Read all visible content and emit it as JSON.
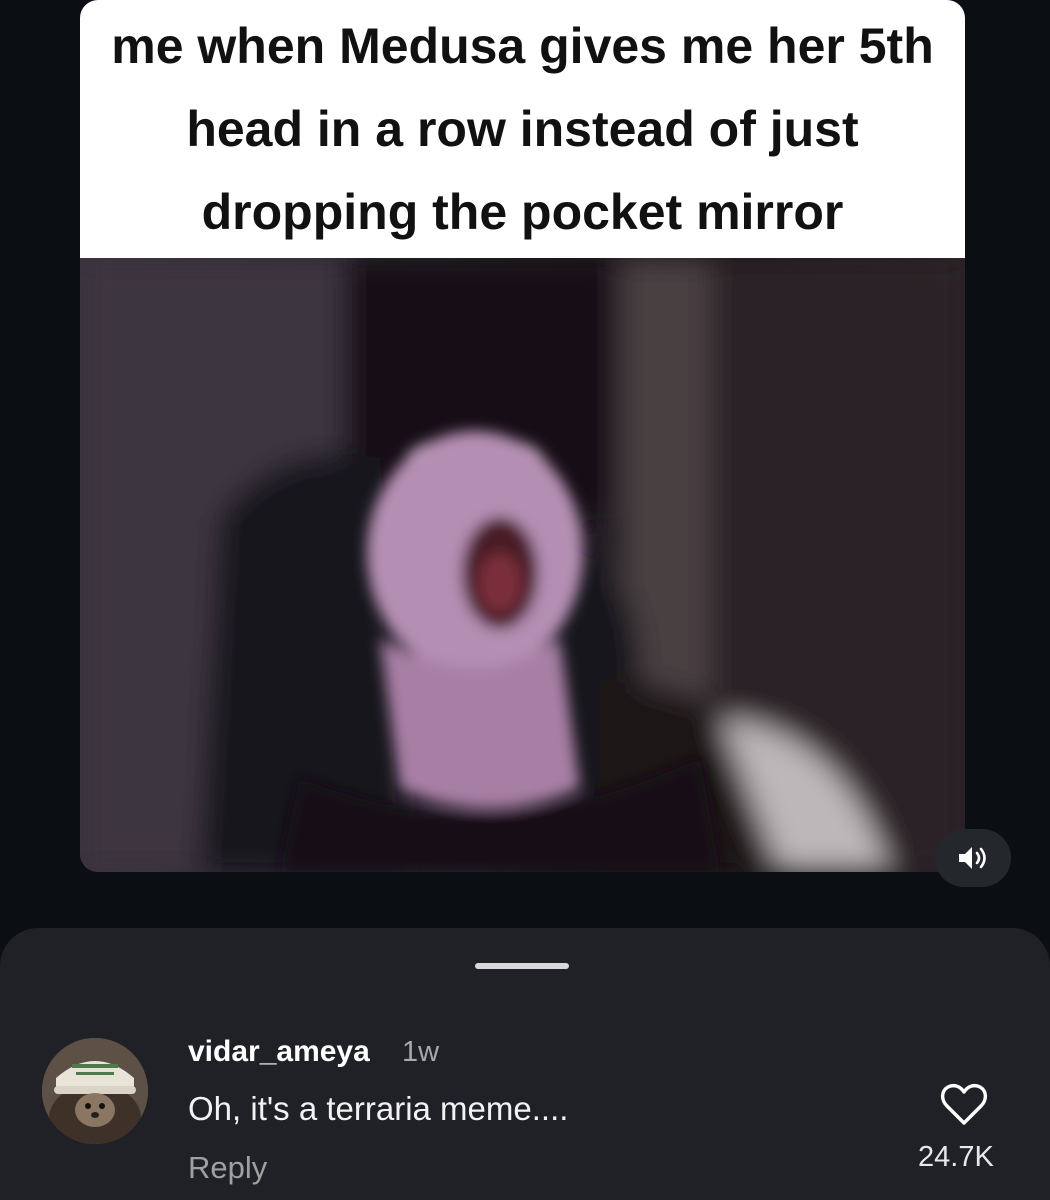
{
  "post": {
    "caption": "me when Medusa gives me her 5th head in a row instead of just dropping the pocket mirror",
    "media_icon": "speaker-icon"
  },
  "comment": {
    "username": "vidar_ameya",
    "time": "1w",
    "text": "Oh, it's a terraria meme....",
    "reply_label": "Reply",
    "like_count": "24.7K",
    "like_icon": "heart-outline-icon"
  },
  "colors": {
    "background": "#0b0e13",
    "sheet": "#1f2127",
    "caption_bg": "#ffffff",
    "caption_text": "#111111",
    "secondary_text": "#a0a0a0"
  }
}
